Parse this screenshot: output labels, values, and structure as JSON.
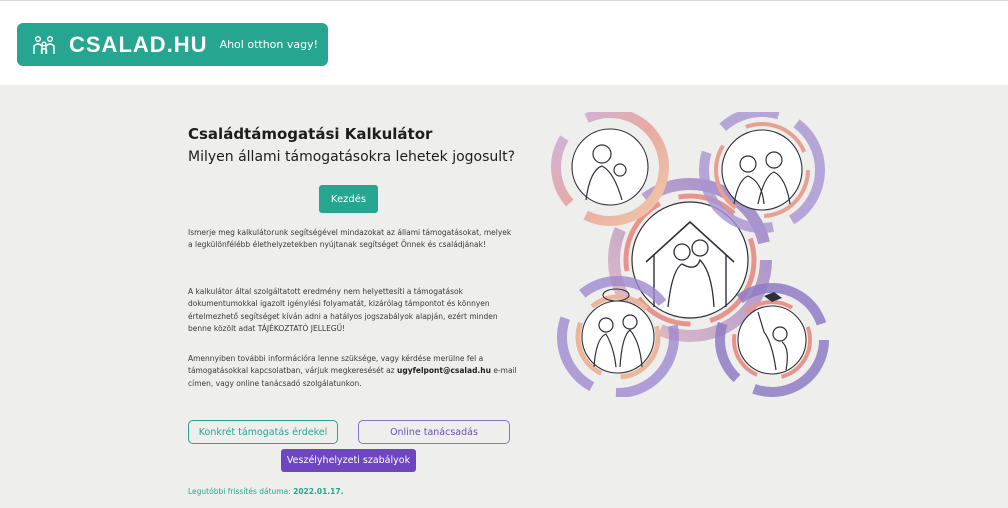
{
  "header": {
    "logo_text": "CSALAD.HU",
    "tagline": "Ahol otthon vagy!"
  },
  "main": {
    "title": "Családtámogatási Kalkulátor",
    "subtitle": "Milyen állami támogatásokra lehetek jogosult?",
    "start_label": "Kezdés",
    "paragraph1": "Ismerje meg kalkulátorunk segítségével mindazokat az állami támogatásokat, melyek a legkülönfélébb élethelyzetekben nyújtanak segítséget Önnek és családjának!",
    "paragraph2": "A kalkulátor által szolgáltatott eredmény nem helyettesíti a támogatások dokumentumokkal igazolt igénylési folyamatát, kizárólag támpontot és könnyen értelmezhető segítséget kíván adni a hatályos jogszabályok alapján, ezért minden benne közölt adat TÁJÉKOZTATÓ JELLEGŰ!",
    "paragraph3_before": "Amennyiben további információra lenne szüksége, vagy kérdése merülne fel a támogatásokkal kapcsolatban, várjuk megkeresését az ",
    "paragraph3_email": "ugyfelpont@csalad.hu",
    "paragraph3_after": " e-mail címen, vagy online tanácsadó szolgálatunkon.",
    "btn_konkret": "Konkrét támogatás érdekel",
    "btn_online": "Online tanácsadás",
    "btn_veszely": "Veszélyhelyzeti szabályok",
    "update_label": "Legutóbbi frissítés dátuma: ",
    "update_date": "2022.01.17."
  },
  "colors": {
    "brand_green": "#26a690",
    "brand_purple": "#6e45c2",
    "background": "#eeeeec"
  },
  "icons": {
    "logo": "family-icon"
  }
}
